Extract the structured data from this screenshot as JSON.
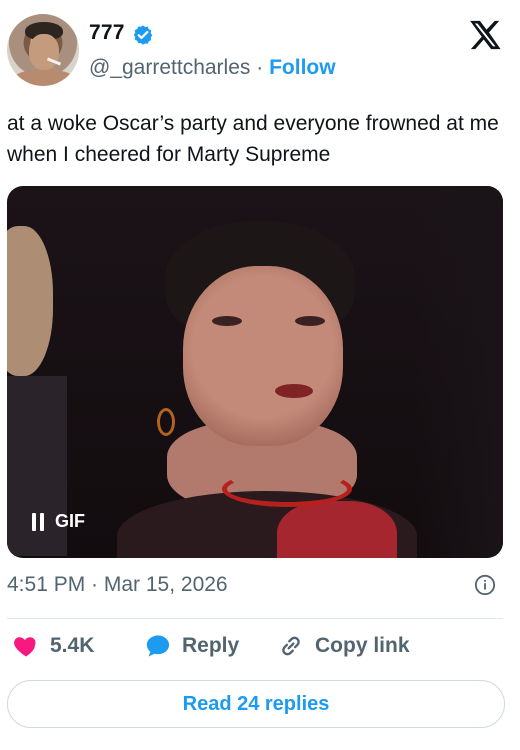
{
  "author": {
    "display_name": "777",
    "handle": "@_garrettcharles",
    "separator": "·",
    "follow_label": "Follow"
  },
  "tweet": {
    "text": "at a woke Oscar’s party and everyone frowned at me when I cheered for Marty Supreme"
  },
  "media": {
    "gif_label": "GIF",
    "control": "pause"
  },
  "meta": {
    "timestamp": "4:51 PM · Mar 15, 2026"
  },
  "actions": {
    "likes": "5.4K",
    "reply_label": "Reply",
    "copy_link_label": "Copy link"
  },
  "footer": {
    "read_replies_label": "Read 24 replies"
  },
  "colors": {
    "accent": "#1d9bf0",
    "like": "#f91880",
    "muted": "#536471",
    "text": "#0f1419"
  }
}
